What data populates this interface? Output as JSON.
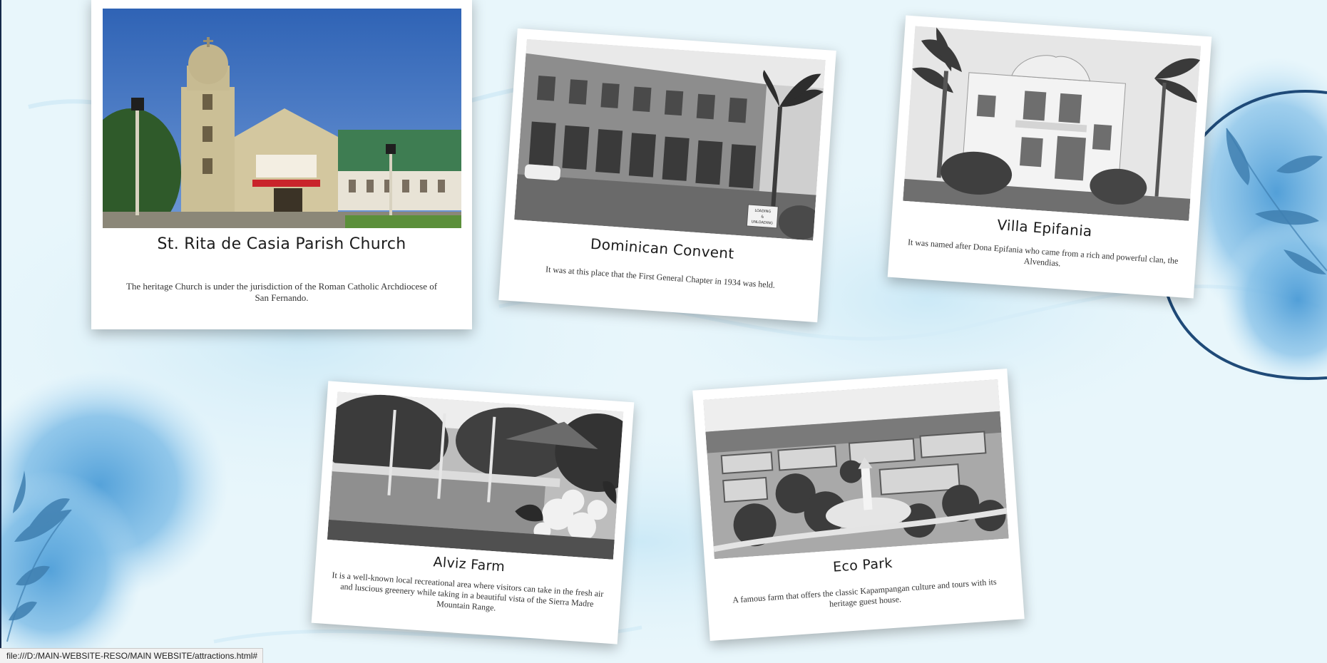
{
  "cards": [
    {
      "title": "St. Rita de Casia Parish Church",
      "description": "The heritage Church is under the jurisdiction of the Roman Catholic Archdiocese of San Fernando."
    },
    {
      "title": "Dominican Convent",
      "description": "It was at this place that the First General Chapter in 1934 was held."
    },
    {
      "title": "Villa Epifania",
      "description": "It was named after Dona Epifania who came from a rich and powerful clan, the Alvendias."
    },
    {
      "title": "Alviz Farm",
      "description": "It is a well-known local recreational area where visitors can take in the fresh air and luscious greenery while taking in a beautiful vista of the Sierra Madre Mountain Range."
    },
    {
      "title": "Eco Park",
      "description": "A famous farm that offers the classic Kapampangan culture and tours with its heritage guest house."
    }
  ],
  "photo_signs": {
    "loading_sign_line1": "LOADING",
    "loading_sign_line2": "&",
    "loading_sign_line3": "UNLOADING"
  },
  "status_bar": {
    "url": "file:///D:/MAIN-WEBSITE-RESO/MAIN WEBSITE/attractions.html#"
  },
  "colors": {
    "background": "#e6f5fb",
    "watercolor_blue": "#5aa7dd",
    "leaf_blue": "#3f7fb0",
    "arc_navy": "#1f4a78",
    "card_white": "#ffffff"
  }
}
